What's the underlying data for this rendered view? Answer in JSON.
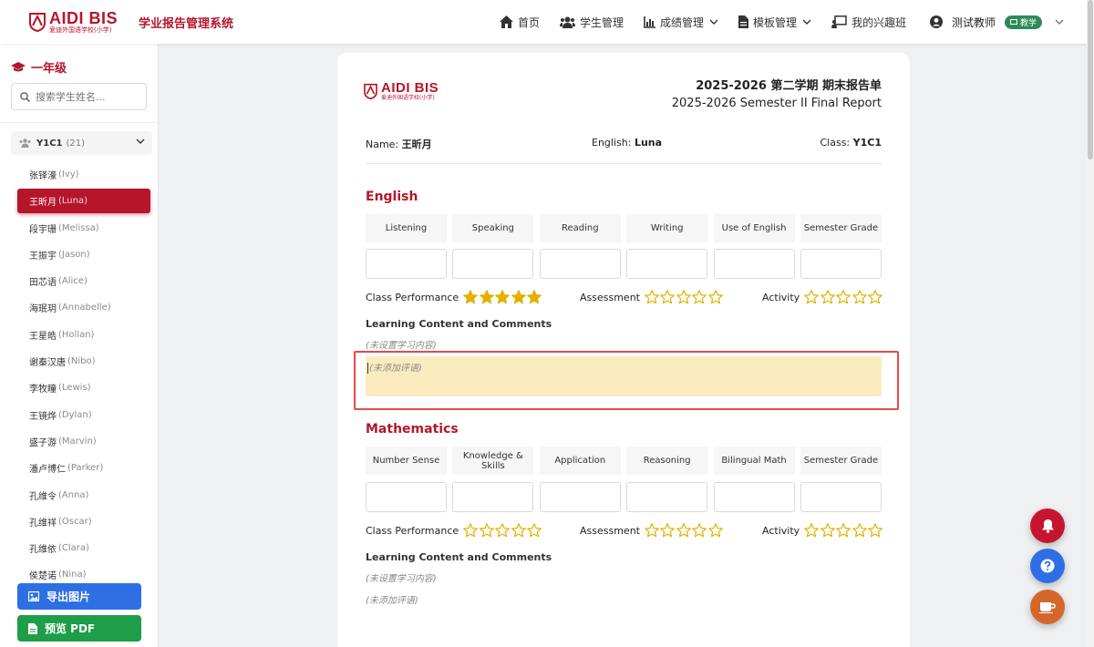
{
  "app": {
    "logo_main": "AIDI BIS",
    "logo_sub": "爱迪外国语学校(小学)",
    "system_title": "学业报告管理系统"
  },
  "nav": {
    "items": [
      {
        "label": "首页",
        "icon": "home-icon"
      },
      {
        "label": "学生管理",
        "icon": "users-icon"
      },
      {
        "label": "成绩管理",
        "icon": "chart-icon",
        "dropdown": true
      },
      {
        "label": "模板管理",
        "icon": "file-icon",
        "dropdown": true
      },
      {
        "label": "我的兴趣班",
        "icon": "chalkboard-icon"
      }
    ]
  },
  "user": {
    "name": "测试教师",
    "role_badge": "教学"
  },
  "sidebar": {
    "grade": "一年级",
    "search_placeholder": "搜索学生姓名...",
    "class_name": "Y1C1",
    "class_count": "(21)",
    "students": [
      {
        "cn": "张铎濠",
        "en": "(Ivy)"
      },
      {
        "cn": "王昕月",
        "en": "(Luna)",
        "active": true
      },
      {
        "cn": "段宇珊",
        "en": "(Melissa)"
      },
      {
        "cn": "王振宇",
        "en": "(Jason)"
      },
      {
        "cn": "田芯语",
        "en": "(Alice)"
      },
      {
        "cn": "海珉玥",
        "en": "(Annabelle)"
      },
      {
        "cn": "王星皓",
        "en": "(Hollan)"
      },
      {
        "cn": "谢秦汉唐",
        "en": "(Nibo)"
      },
      {
        "cn": "李牧瞳",
        "en": "(Lewis)"
      },
      {
        "cn": "王镜烨",
        "en": "(Dylan)"
      },
      {
        "cn": "盛子游",
        "en": "(Marvin)"
      },
      {
        "cn": "潘卢博仁",
        "en": "(Parker)"
      },
      {
        "cn": "孔维令",
        "en": "(Anna)"
      },
      {
        "cn": "孔维祥",
        "en": "(Oscar)"
      },
      {
        "cn": "孔维依",
        "en": "(Clara)"
      },
      {
        "cn": "侯楚诺",
        "en": "(Nina)"
      }
    ],
    "export_button": "导出图片",
    "pdf_button": "预览 PDF"
  },
  "report": {
    "title_cn": "2025-2026 第二学期 期末报告单",
    "title_en": "2025-2026 Semester II Final Report",
    "name_label": "Name:",
    "name_value": "王昕月",
    "english_label": "English:",
    "english_value": "Luna",
    "class_label": "Class:",
    "class_value": "Y1C1",
    "sections": [
      {
        "title": "English",
        "columns": [
          "Listening",
          "Speaking",
          "Reading",
          "Writing",
          "Use of English",
          "Semester Grade"
        ],
        "class_performance": {
          "label": "Class Performance",
          "stars": 5,
          "max": 5
        },
        "assessment": {
          "label": "Assessment",
          "stars": 0,
          "max": 5
        },
        "activity": {
          "label": "Activity",
          "stars": 0,
          "max": 5
        },
        "lc_title": "Learning Content and Comments",
        "content": "(未设置学习内容)",
        "comment": "(未添加评语)"
      },
      {
        "title": "Mathematics",
        "columns": [
          "Number Sense",
          "Knowledge & Skills",
          "Application",
          "Reasoning",
          "Bilingual Math",
          "Semester Grade"
        ],
        "class_performance": {
          "label": "Class Performance",
          "stars": 0,
          "max": 5
        },
        "assessment": {
          "label": "Assessment",
          "stars": 0,
          "max": 5
        },
        "activity": {
          "label": "Activity",
          "stars": 0,
          "max": 5
        },
        "lc_title": "Learning Content and Comments",
        "content": "(未设置学习内容)",
        "comment": "(未添加评语)"
      }
    ]
  },
  "colors": {
    "brand_red": "#b5162b",
    "star_gold": "#e3b100",
    "comment_highlight": "#fbecc0",
    "export_blue": "#2f6fe4",
    "pdf_green": "#1e9e48"
  },
  "fabs": [
    "bell-icon",
    "help-icon",
    "coffee-icon"
  ]
}
